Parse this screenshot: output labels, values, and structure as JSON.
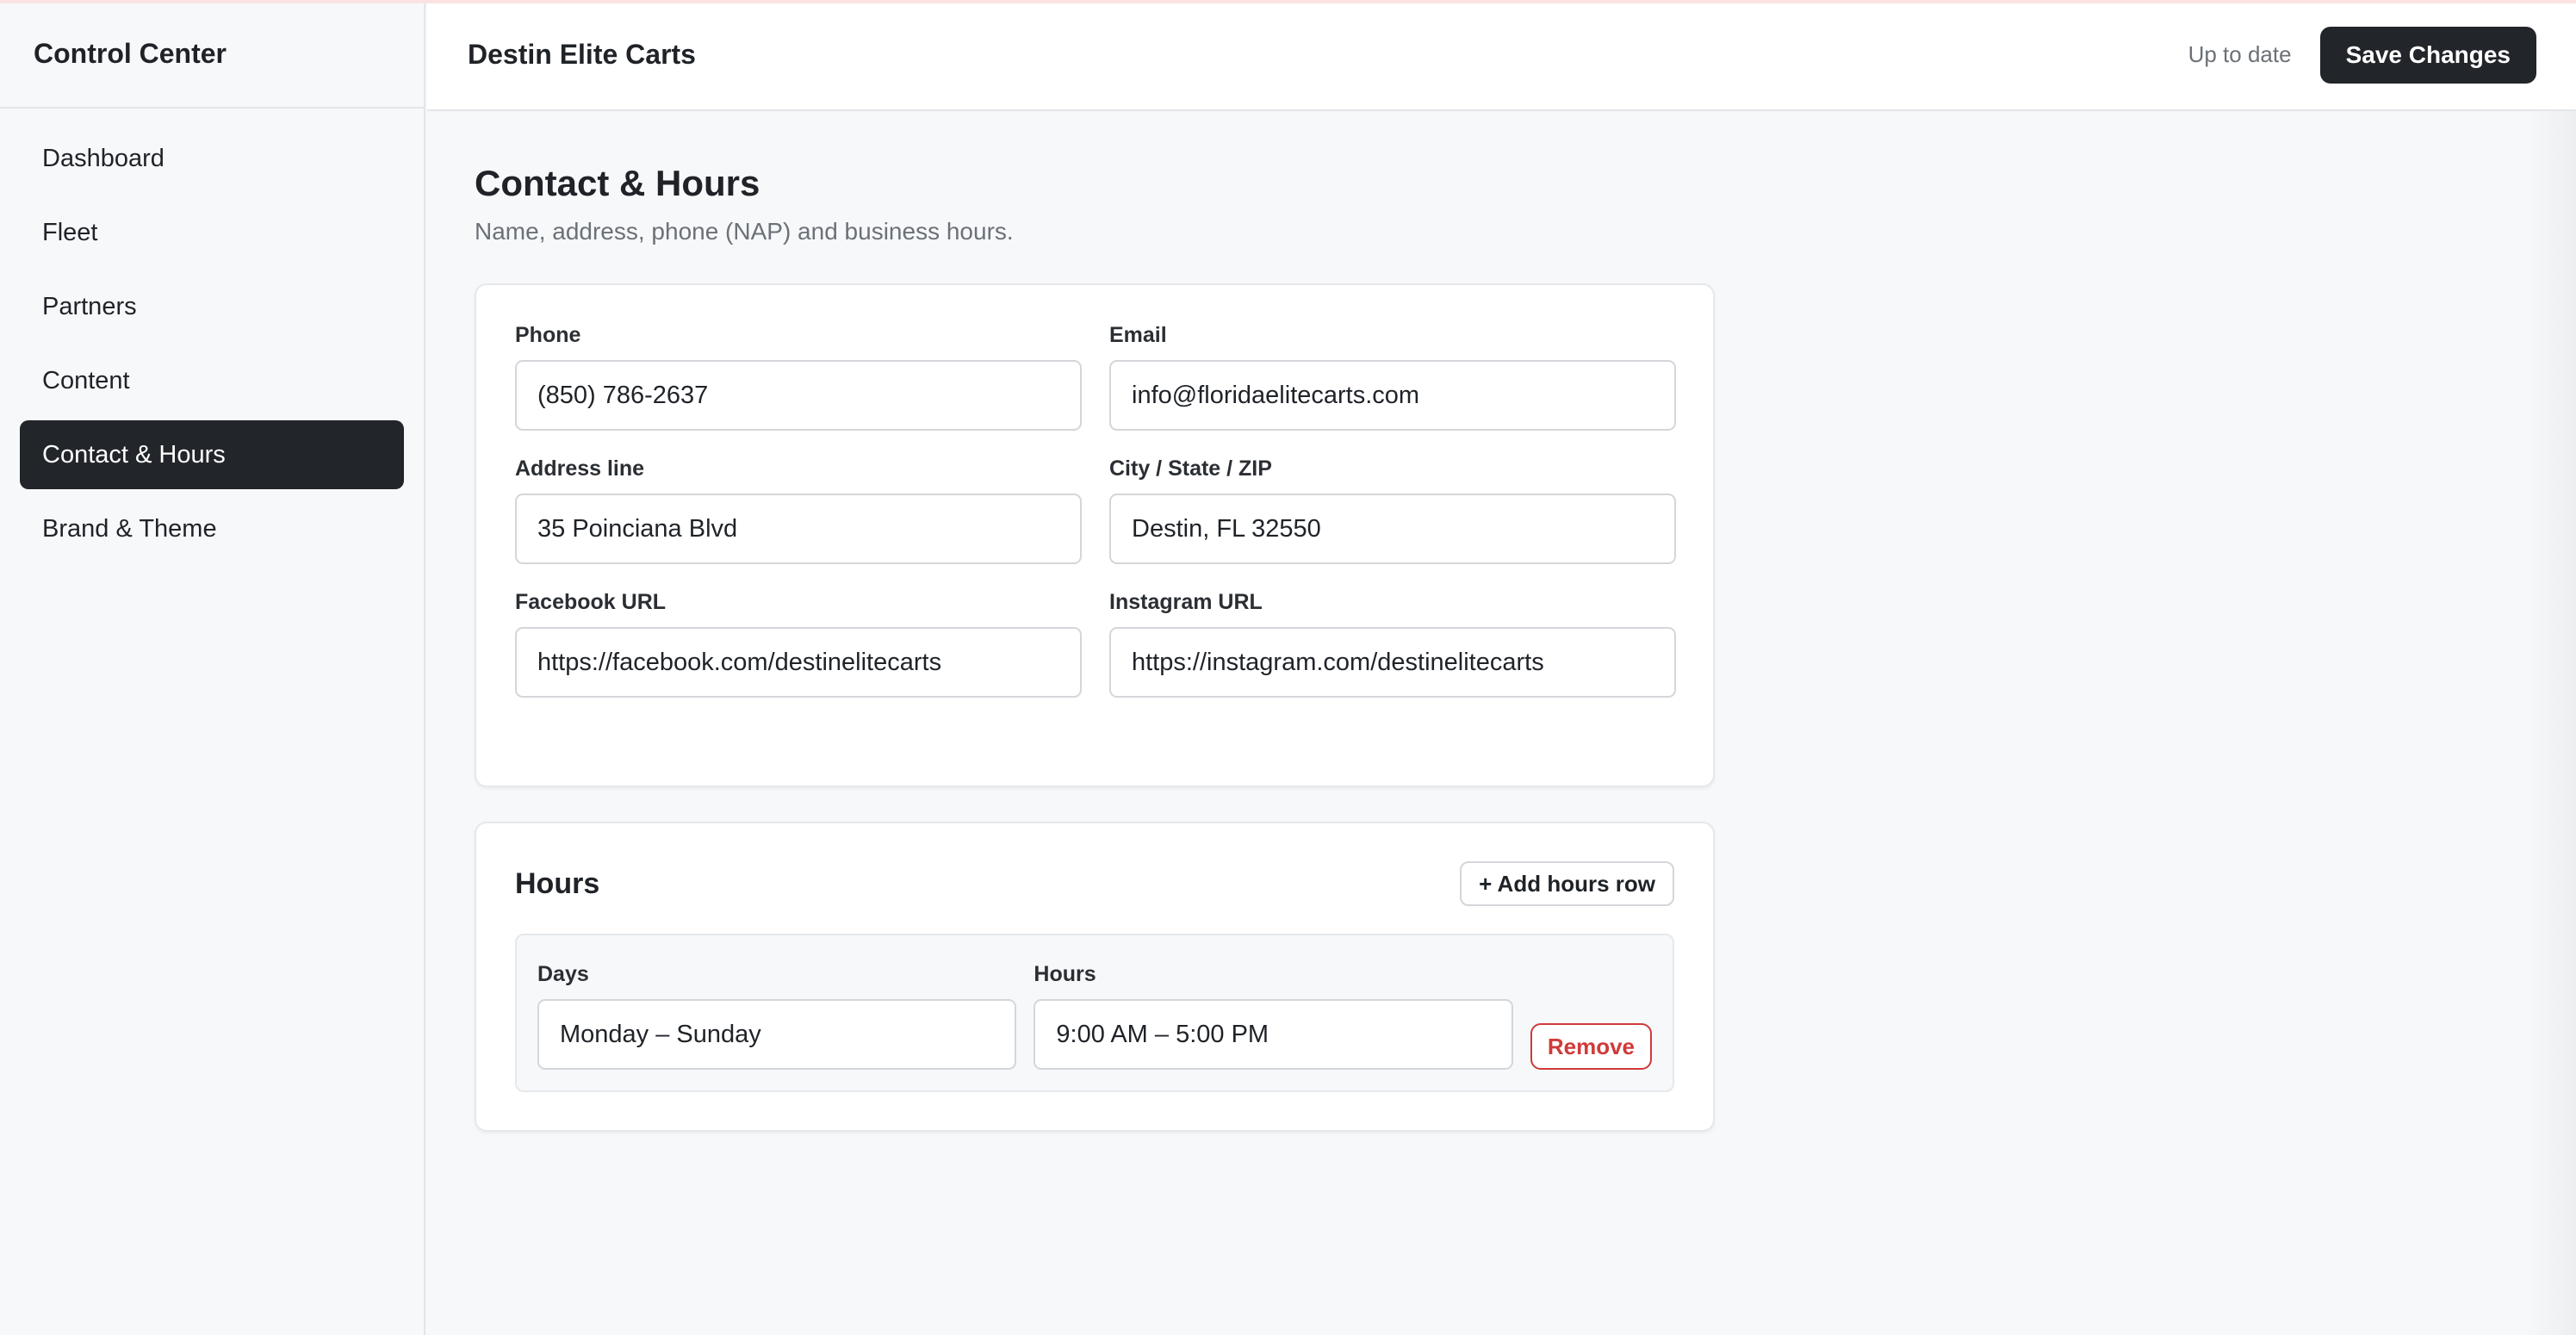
{
  "sidebar": {
    "title": "Control Center",
    "items": [
      {
        "label": "Dashboard",
        "active": false
      },
      {
        "label": "Fleet",
        "active": false
      },
      {
        "label": "Partners",
        "active": false
      },
      {
        "label": "Content",
        "active": false
      },
      {
        "label": "Contact & Hours",
        "active": true
      },
      {
        "label": "Brand & Theme",
        "active": false
      }
    ]
  },
  "header": {
    "site_name": "Destin Elite Carts",
    "status": "Up to date",
    "save_label": "Save Changes"
  },
  "page": {
    "title": "Contact & Hours",
    "subtitle": "Name, address, phone (NAP) and business hours."
  },
  "contact": {
    "phone_label": "Phone",
    "phone_value": "(850) 786-2637",
    "email_label": "Email",
    "email_value": "info@floridaelitecarts.com",
    "address_label": "Address line",
    "address_value": "35 Poinciana Blvd",
    "city_label": "City / State / ZIP",
    "city_value": "Destin, FL 32550",
    "facebook_label": "Facebook URL",
    "facebook_value": "https://facebook.com/destinelitecarts",
    "instagram_label": "Instagram URL",
    "instagram_value": "https://instagram.com/destinelitecarts"
  },
  "hours": {
    "title": "Hours",
    "add_label": "+ Add hours row",
    "rows": [
      {
        "days_label": "Days",
        "days_value": "Monday – Sunday",
        "hours_label": "Hours",
        "hours_value": "9:00 AM – 5:00 PM",
        "remove_label": "Remove"
      }
    ]
  },
  "colors": {
    "accent_dark": "#22252a",
    "danger": "#d03a3a",
    "muted_text": "#6b7177"
  }
}
